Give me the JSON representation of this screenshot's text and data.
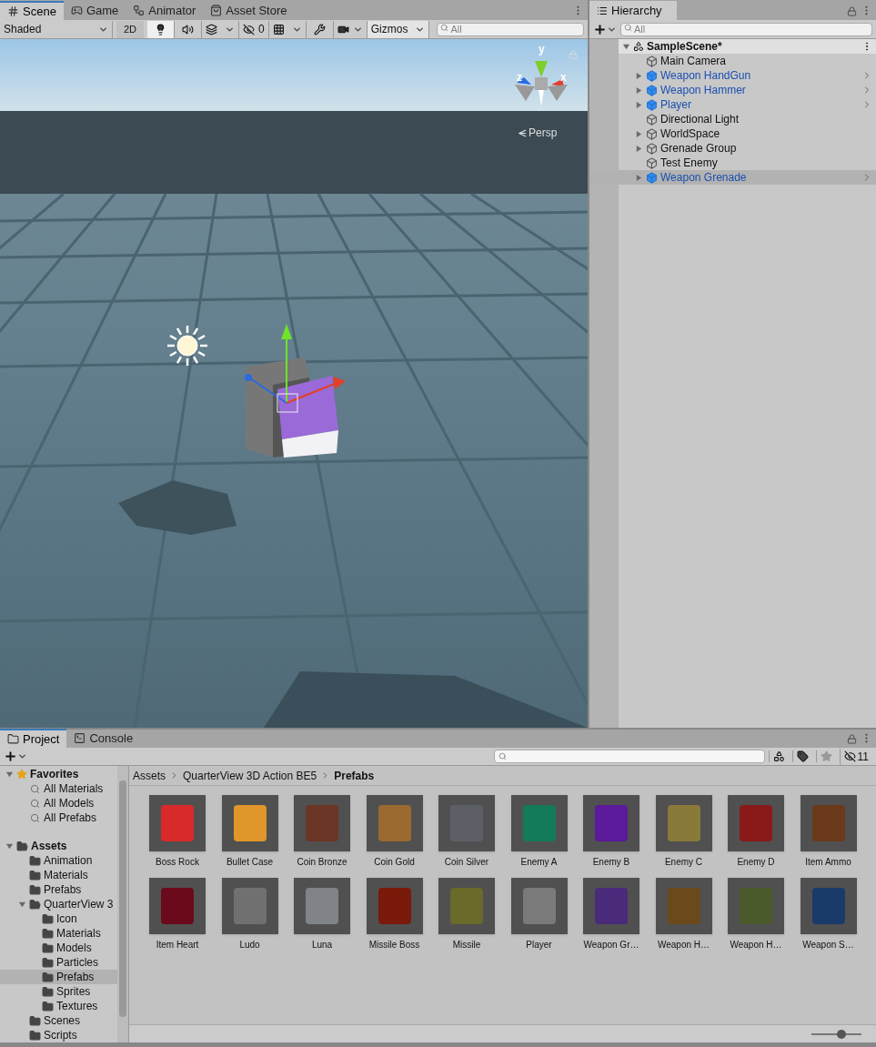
{
  "scene_window": {
    "tabs": [
      {
        "label": "Scene",
        "selected": true
      },
      {
        "label": "Game",
        "selected": false
      },
      {
        "label": "Animator",
        "selected": false
      },
      {
        "label": "Asset Store",
        "selected": false
      }
    ],
    "toolbar": {
      "shading": "Shaded",
      "mode_2d": {
        "label": "2D",
        "on": false
      },
      "lighting_on": true,
      "audio_on": false,
      "hidden_count": "0",
      "gizmos": "Gizmos",
      "search_placeholder": "All"
    },
    "viewport": {
      "gizmo_axes": [
        "y",
        "z",
        "x"
      ],
      "projection": "Persp"
    }
  },
  "hierarchy": {
    "tab": "Hierarchy",
    "search_placeholder": "All",
    "scene": {
      "name": "SampleScene*",
      "expanded": true
    },
    "items": [
      {
        "name": "Main Camera",
        "prefab": false,
        "has_children": false,
        "selected": false
      },
      {
        "name": "Weapon HandGun",
        "prefab": true,
        "has_children": true,
        "selected": false
      },
      {
        "name": "Weapon Hammer",
        "prefab": true,
        "has_children": true,
        "selected": false
      },
      {
        "name": "Player",
        "prefab": true,
        "has_children": true,
        "selected": false
      },
      {
        "name": "Directional Light",
        "prefab": false,
        "has_children": false,
        "selected": false
      },
      {
        "name": "WorldSpace",
        "prefab": false,
        "has_children": true,
        "selected": false
      },
      {
        "name": "Grenade Group",
        "prefab": false,
        "has_children": true,
        "selected": false
      },
      {
        "name": "Test Enemy",
        "prefab": false,
        "has_children": false,
        "selected": false
      },
      {
        "name": "Weapon Grenade",
        "prefab": true,
        "has_children": true,
        "selected": true
      }
    ]
  },
  "project": {
    "tabs": [
      {
        "label": "Project",
        "selected": true
      },
      {
        "label": "Console",
        "selected": false
      }
    ],
    "hidden_count": "11",
    "favorites": {
      "label": "Favorites",
      "expanded": true,
      "items": [
        "All Materials",
        "All Models",
        "All Prefabs"
      ]
    },
    "assets": {
      "label": "Assets",
      "expanded": true,
      "children": [
        {
          "label": "Animation",
          "selected": false
        },
        {
          "label": "Materials",
          "selected": false
        },
        {
          "label": "Prefabs",
          "selected": false
        },
        {
          "label": "QuarterView 3",
          "selected": false,
          "expanded": true,
          "children": [
            {
              "label": "Icon",
              "selected": false
            },
            {
              "label": "Materials",
              "selected": false
            },
            {
              "label": "Models",
              "selected": false
            },
            {
              "label": "Particles",
              "selected": false
            },
            {
              "label": "Prefabs",
              "selected": true
            },
            {
              "label": "Sprites",
              "selected": false
            },
            {
              "label": "Textures",
              "selected": false
            }
          ]
        },
        {
          "label": "Scenes",
          "selected": false
        },
        {
          "label": "Scripts",
          "selected": false
        }
      ]
    },
    "breadcrumb": [
      "Assets",
      "QuarterView 3D Action BE5",
      "Prefabs"
    ],
    "items": [
      {
        "name": "Boss Rock",
        "color": "#d82a2a"
      },
      {
        "name": "Bullet Case",
        "color": "#e0962a"
      },
      {
        "name": "Coin Bronze",
        "color": "#6a3524"
      },
      {
        "name": "Coin Gold",
        "color": "#9a6a30"
      },
      {
        "name": "Coin Silver",
        "color": "#5c6066"
      },
      {
        "name": "Enemy A",
        "color": "#137a5a"
      },
      {
        "name": "Enemy B",
        "color": "#5a1a9a"
      },
      {
        "name": "Enemy C",
        "color": "#8a7a3a"
      },
      {
        "name": "Enemy D",
        "color": "#8a1a1a"
      },
      {
        "name": "Item Ammo",
        "color": "#6a3a1a"
      },
      {
        "name": "Item Heart",
        "color": "#6a0a1a"
      },
      {
        "name": "Ludo",
        "color": "#707070"
      },
      {
        "name": "Luna",
        "color": "#808488"
      },
      {
        "name": "Missile Boss",
        "color": "#7a1a0a"
      },
      {
        "name": "Missile",
        "color": "#6a6a2a"
      },
      {
        "name": "Player",
        "color": "#7a7a7a"
      },
      {
        "name": "Weapon Gr…",
        "color": "#4a2a7a"
      },
      {
        "name": "Weapon H…",
        "color": "#6a4a1a"
      },
      {
        "name": "Weapon H…",
        "color": "#4a5a2a"
      },
      {
        "name": "Weapon S…",
        "color": "#1a3a6a"
      }
    ],
    "zoom": {
      "level": 0.6
    }
  }
}
